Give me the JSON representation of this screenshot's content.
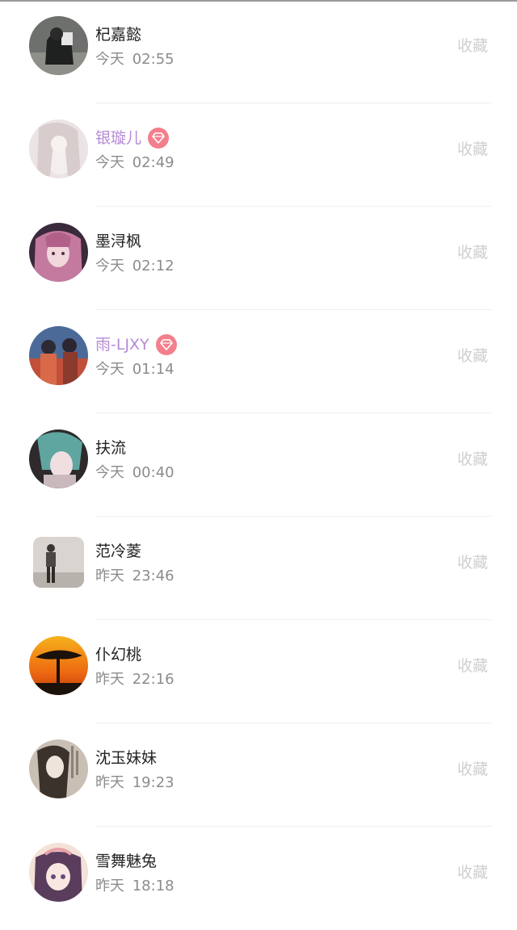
{
  "items": [
    {
      "name": "杞嘉懿",
      "day": "今天",
      "time": "02:55",
      "action": "收藏",
      "vip": false
    },
    {
      "name": "银璇儿",
      "day": "今天",
      "time": "02:49",
      "action": "收藏",
      "vip": true
    },
    {
      "name": "墨浔枫",
      "day": "今天",
      "time": "02:12",
      "action": "收藏",
      "vip": false
    },
    {
      "name": "雨-LJXY",
      "day": "今天",
      "time": "01:14",
      "action": "收藏",
      "vip": true
    },
    {
      "name": "扶流",
      "day": "今天",
      "time": "00:40",
      "action": "收藏",
      "vip": false
    },
    {
      "name": "范冷菱",
      "day": "昨天",
      "time": "23:46",
      "action": "收藏",
      "vip": false
    },
    {
      "name": "仆幻桃",
      "day": "昨天",
      "time": "22:16",
      "action": "收藏",
      "vip": false
    },
    {
      "name": "沈玉妹妹",
      "day": "昨天",
      "time": "19:23",
      "action": "收藏",
      "vip": false
    },
    {
      "name": "雪舞魅兔",
      "day": "昨天",
      "time": "18:18",
      "action": "收藏",
      "vip": false
    }
  ],
  "colors": {
    "vip_name": "#b58ad6",
    "vip_badge": "#f47f8c",
    "action_text": "#cfcfcf",
    "time_text": "#8c8c8c"
  }
}
